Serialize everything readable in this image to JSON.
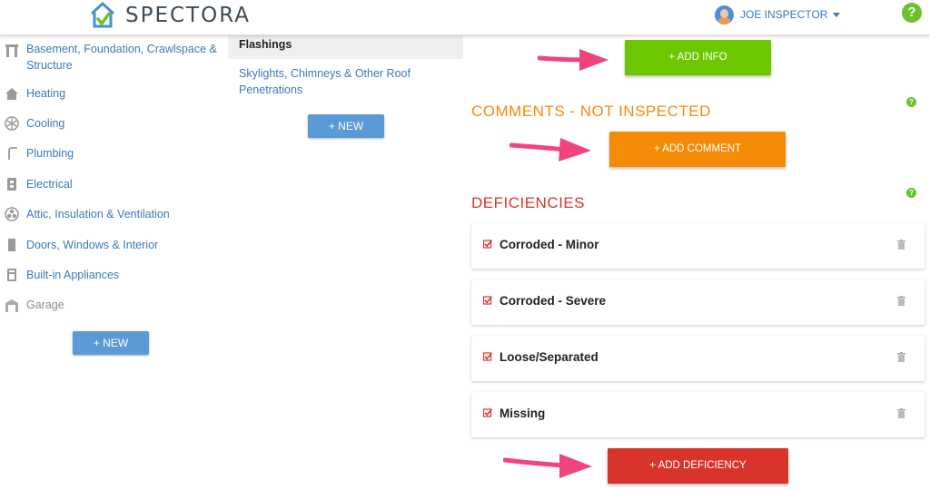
{
  "header": {
    "logo_text": "SPECTORA",
    "user_name": "JOE INSPECTOR",
    "help_label": "?"
  },
  "sidebar": {
    "items": [
      {
        "label": "Basement, Foundation, Crawlspace & Structure",
        "icon": "basement-icon"
      },
      {
        "label": "Heating",
        "icon": "house-icon"
      },
      {
        "label": "Cooling",
        "icon": "snowflake-icon"
      },
      {
        "label": "Plumbing",
        "icon": "pipe-icon"
      },
      {
        "label": "Electrical",
        "icon": "outlet-icon"
      },
      {
        "label": "Attic, Insulation & Ventilation",
        "icon": "fan-icon"
      },
      {
        "label": "Doors, Windows & Interior",
        "icon": "door-icon"
      },
      {
        "label": "Built-in Appliances",
        "icon": "appliance-icon"
      },
      {
        "label": "Garage",
        "icon": "garage-icon"
      }
    ],
    "new_button": "+ NEW"
  },
  "middle": {
    "active_item": "Flashings",
    "items": [
      "Skylights, Chimneys & Other Roof Penetrations"
    ],
    "new_button": "+ NEW"
  },
  "right": {
    "add_info_button": "+ ADD INFO",
    "comments_title": "COMMENTS - NOT INSPECTED",
    "add_comment_button": "+ ADD COMMENT",
    "deficiencies_title": "DEFICIENCIES",
    "deficiencies": [
      {
        "label": "Corroded - Minor"
      },
      {
        "label": "Corroded - Severe"
      },
      {
        "label": "Loose/Separated"
      },
      {
        "label": "Missing"
      }
    ],
    "add_deficiency_button": "+ ADD DEFICIENCY",
    "help_label": "?"
  },
  "colors": {
    "brand_blue": "#3a7ab8",
    "green": "#6cc700",
    "orange": "#f58a07",
    "red": "#d9342b",
    "arrow_pink": "#f0457a"
  }
}
